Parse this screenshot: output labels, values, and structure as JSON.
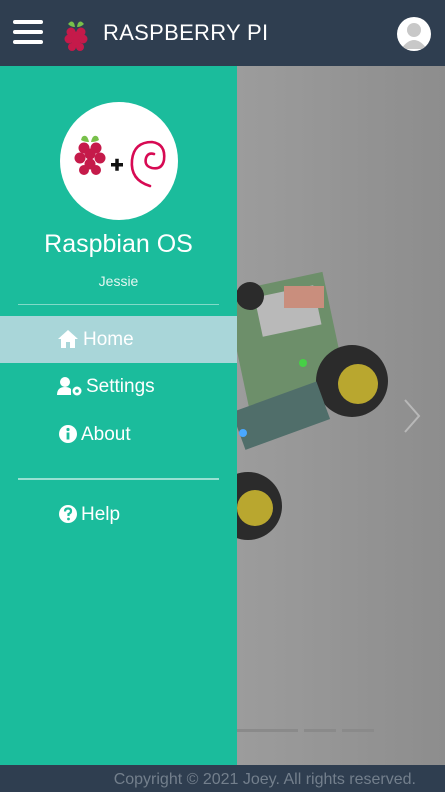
{
  "header": {
    "title": "RASPBERRY PI",
    "menu_icon": "hamburger-icon",
    "logo_icon": "raspberry-icon",
    "avatar_icon": "user-avatar-icon"
  },
  "drawer": {
    "profile_logos": [
      "raspberry-icon",
      "plus-icon",
      "debian-swirl-icon"
    ],
    "os_name": "Raspbian OS",
    "os_version": "Jessie",
    "nav": [
      {
        "label": "Home",
        "icon": "home-icon",
        "active": true
      },
      {
        "label": "Settings",
        "icon": "users-cog-icon",
        "active": false
      },
      {
        "label": "About",
        "icon": "info-circle-icon",
        "active": false
      }
    ],
    "secondary_nav": [
      {
        "label": "Help",
        "icon": "question-circle-icon"
      }
    ]
  },
  "carousel": {
    "next_icon": "chevron-right-icon",
    "indicator_count": 4
  },
  "footer": {
    "copyright": "Copyright © 2021 Joey. All rights reserved."
  },
  "colors": {
    "header_bg": "#2f3e50",
    "drawer_bg": "#1bbc9c",
    "active_item_bg": "#a9d6d9"
  }
}
